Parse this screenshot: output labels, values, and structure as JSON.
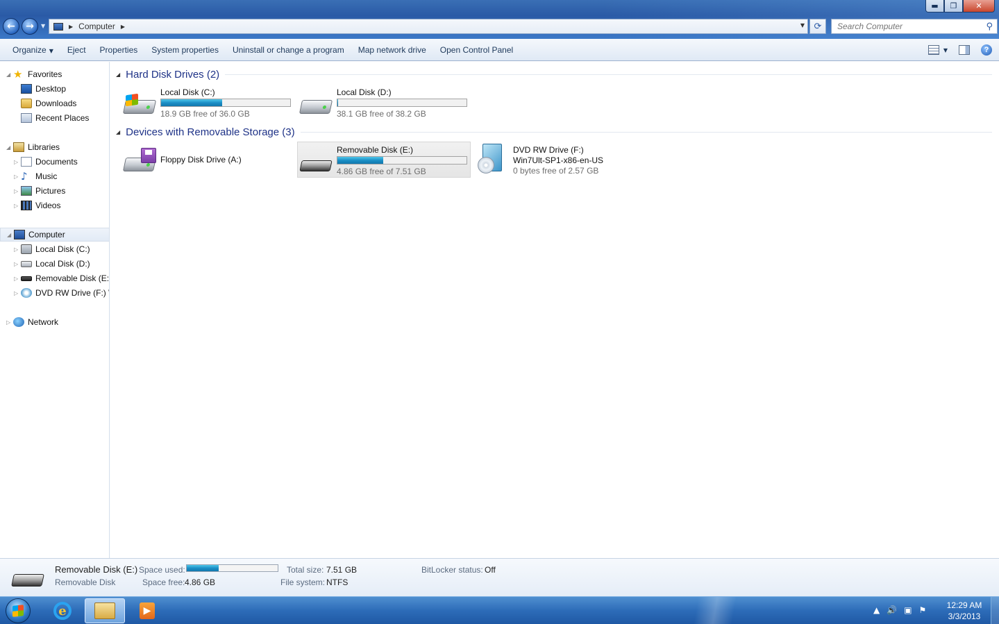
{
  "window": {
    "address_crumb": "Computer",
    "search_placeholder": "Search Computer",
    "buttons": {
      "minimize": "▬",
      "restore": "❐",
      "close": "✕"
    }
  },
  "toolbar": {
    "organize": "Organize",
    "eject": "Eject",
    "properties": "Properties",
    "system_properties": "System properties",
    "uninstall": "Uninstall or change a program",
    "map_drive": "Map network drive",
    "control_panel": "Open Control Panel",
    "help": "?"
  },
  "sidebar": {
    "favorites": {
      "label": "Favorites",
      "items": [
        "Desktop",
        "Downloads",
        "Recent Places"
      ]
    },
    "libraries": {
      "label": "Libraries",
      "items": [
        "Documents",
        "Music",
        "Pictures",
        "Videos"
      ]
    },
    "computer": {
      "label": "Computer",
      "items": [
        "Local Disk (C:)",
        "Local Disk (D:)",
        "Removable Disk (E:)",
        "DVD RW Drive (F:) W"
      ]
    },
    "network": {
      "label": "Network"
    }
  },
  "content": {
    "groups": [
      {
        "title": "Hard Disk Drives (2)"
      },
      {
        "title": "Devices with Removable Storage (3)"
      }
    ],
    "drives": [
      {
        "name": "Local Disk (C:)",
        "free_text": "18.9 GB free of 36.0 GB",
        "used_fraction": 0.475
      },
      {
        "name": "Local Disk (D:)",
        "free_text": "38.1 GB free of 38.2 GB",
        "used_fraction": 0.003
      },
      {
        "name": "Floppy Disk Drive (A:)"
      },
      {
        "name": "Removable Disk (E:)",
        "free_text": "4.86 GB free of 7.51 GB",
        "used_fraction": 0.353
      },
      {
        "name": "DVD RW Drive (F:)",
        "volume": "Win7Ult-SP1-x86-en-US",
        "free_text": "0 bytes free of 2.57 GB"
      }
    ]
  },
  "details": {
    "name": "Removable Disk (E:)",
    "type": "Removable Disk",
    "space_used_label": "Space used:",
    "space_used_fraction": 0.353,
    "space_free_label": "Space free:",
    "space_free": "4.86 GB",
    "total_size_label": "Total size:",
    "total_size": "7.51 GB",
    "file_system_label": "File system:",
    "file_system": "NTFS",
    "bitlocker_label": "BitLocker status:",
    "bitlocker": "Off"
  },
  "taskbar": {
    "time": "12:29 AM",
    "date": "3/3/2013"
  }
}
